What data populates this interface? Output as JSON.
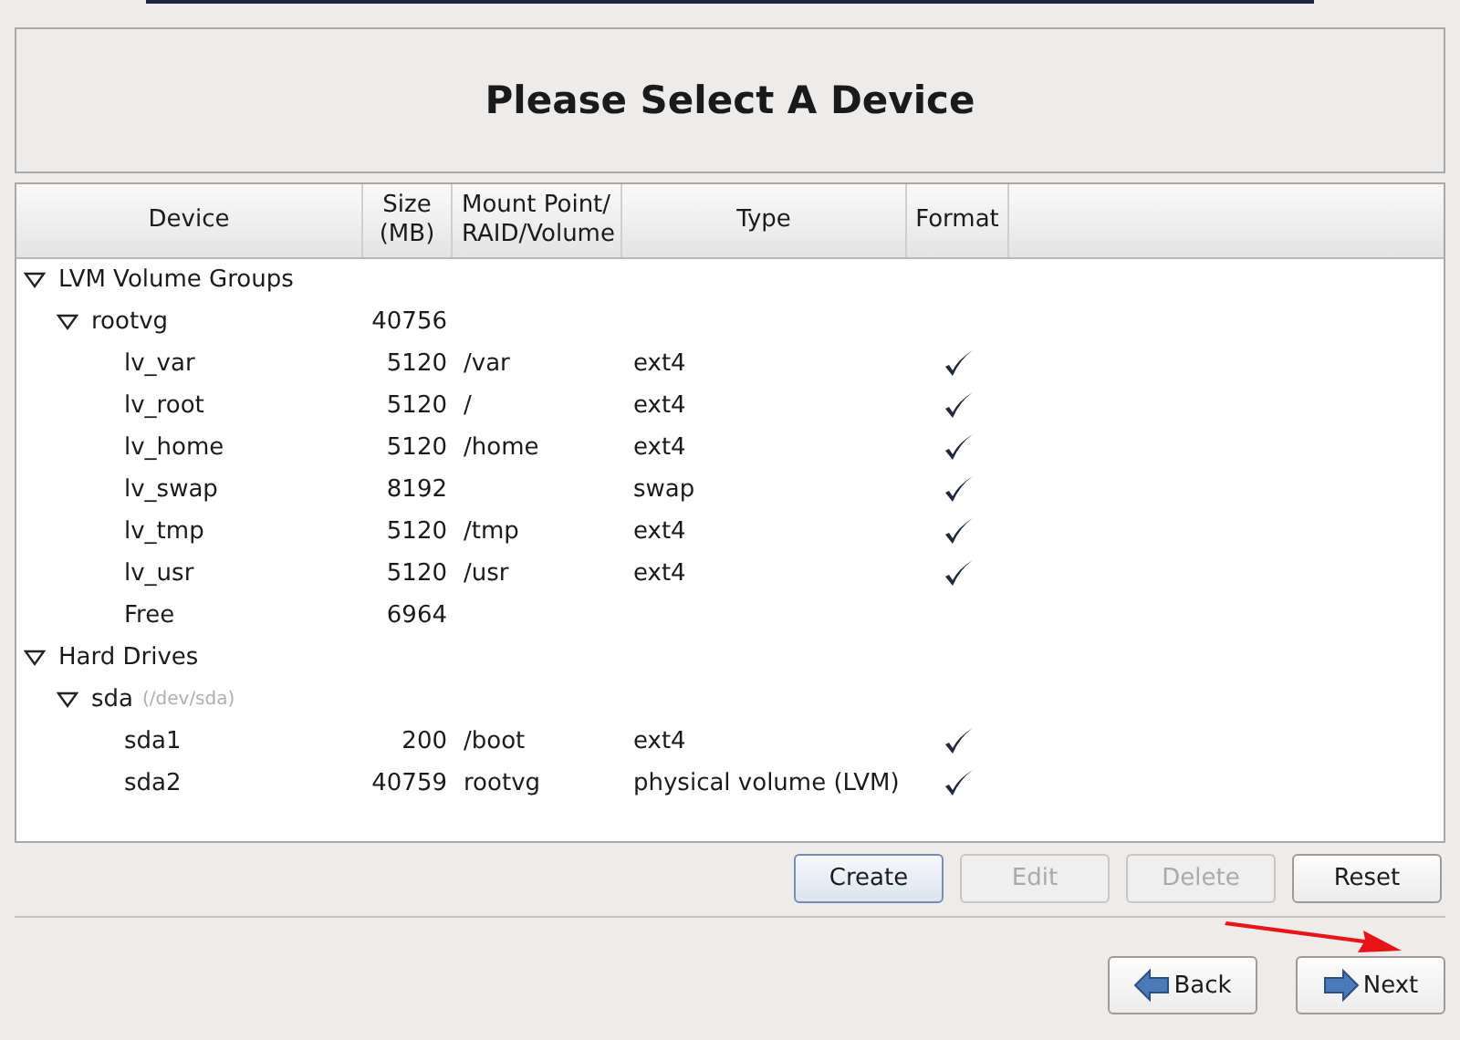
{
  "title": "Please Select A Device",
  "table": {
    "columns": [
      "Device",
      "Size\n(MB)",
      "Mount Point/\nRAID/Volume",
      "Type",
      "Format"
    ],
    "rows": [
      {
        "device": "LVM Volume Groups",
        "expanded": true,
        "children": [
          {
            "device": "rootvg",
            "size": "40756",
            "expanded": true,
            "children": [
              {
                "device": "lv_var",
                "size": "5120",
                "mount": "/var",
                "type": "ext4",
                "format": true
              },
              {
                "device": "lv_root",
                "size": "5120",
                "mount": "/",
                "type": "ext4",
                "format": true
              },
              {
                "device": "lv_home",
                "size": "5120",
                "mount": "/home",
                "type": "ext4",
                "format": true
              },
              {
                "device": "lv_swap",
                "size": "8192",
                "type": "swap",
                "format": true
              },
              {
                "device": "lv_tmp",
                "size": "5120",
                "mount": "/tmp",
                "type": "ext4",
                "format": true
              },
              {
                "device": "lv_usr",
                "size": "5120",
                "mount": "/usr",
                "type": "ext4",
                "format": true
              },
              {
                "device": "Free",
                "size": "6964"
              }
            ]
          }
        ]
      },
      {
        "device": "Hard Drives",
        "expanded": true,
        "children": [
          {
            "device": "sda",
            "hint": "(/dev/sda)",
            "expanded": true,
            "children": [
              {
                "device": "sda1",
                "size": "200",
                "mount": "/boot",
                "type": "ext4",
                "format": true
              },
              {
                "device": "sda2",
                "size": "40759",
                "mount": "rootvg",
                "type": "physical volume (LVM)",
                "format": true
              }
            ]
          }
        ]
      }
    ]
  },
  "actions": [
    {
      "label": "Create",
      "disabled": false,
      "selected": true
    },
    {
      "label": "Edit",
      "disabled": true,
      "selected": false
    },
    {
      "label": "Delete",
      "disabled": true,
      "selected": false
    },
    {
      "label": "Reset",
      "disabled": false,
      "selected": false
    }
  ],
  "navigation": [
    {
      "label": "Back",
      "kind": "back"
    },
    {
      "label": "Next",
      "kind": "next"
    }
  ]
}
